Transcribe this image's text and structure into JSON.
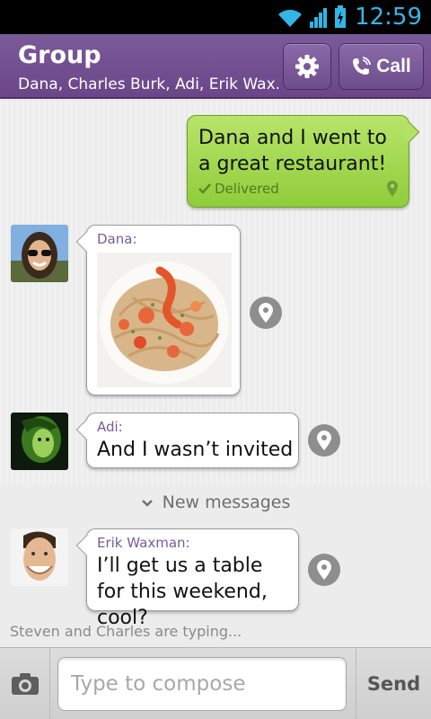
{
  "status_bar": {
    "time": "12:59",
    "icons": [
      "wifi-icon",
      "signal-icon",
      "battery-icon"
    ]
  },
  "header": {
    "title": "Group",
    "subtitle": "Dana, Charles Burk, Adi, Erik Wax...",
    "settings_icon": "gear-icon",
    "call_label": "Call"
  },
  "messages": [
    {
      "sender": "",
      "text": "Dana and I went to a great restaurant!",
      "status": "Delivered",
      "outgoing": true
    },
    {
      "sender": "Dana:",
      "type": "image",
      "image_desc": "plate of shrimp pasta"
    },
    {
      "sender": "Adi:",
      "text": "And I wasn’t invited"
    },
    {
      "sender": "Erik Waxman:",
      "text": "I’ll get us a table for this weekend, cool?"
    }
  ],
  "new_messages_label": "New messages",
  "typing_indicator": "Steven and Charles are typing...",
  "compose": {
    "placeholder": "Type to compose",
    "send_label": "Send"
  },
  "colors": {
    "header": "#6e4c8d",
    "outgoing_bubble": "#a5d955",
    "status_accent": "#33b5e5"
  }
}
